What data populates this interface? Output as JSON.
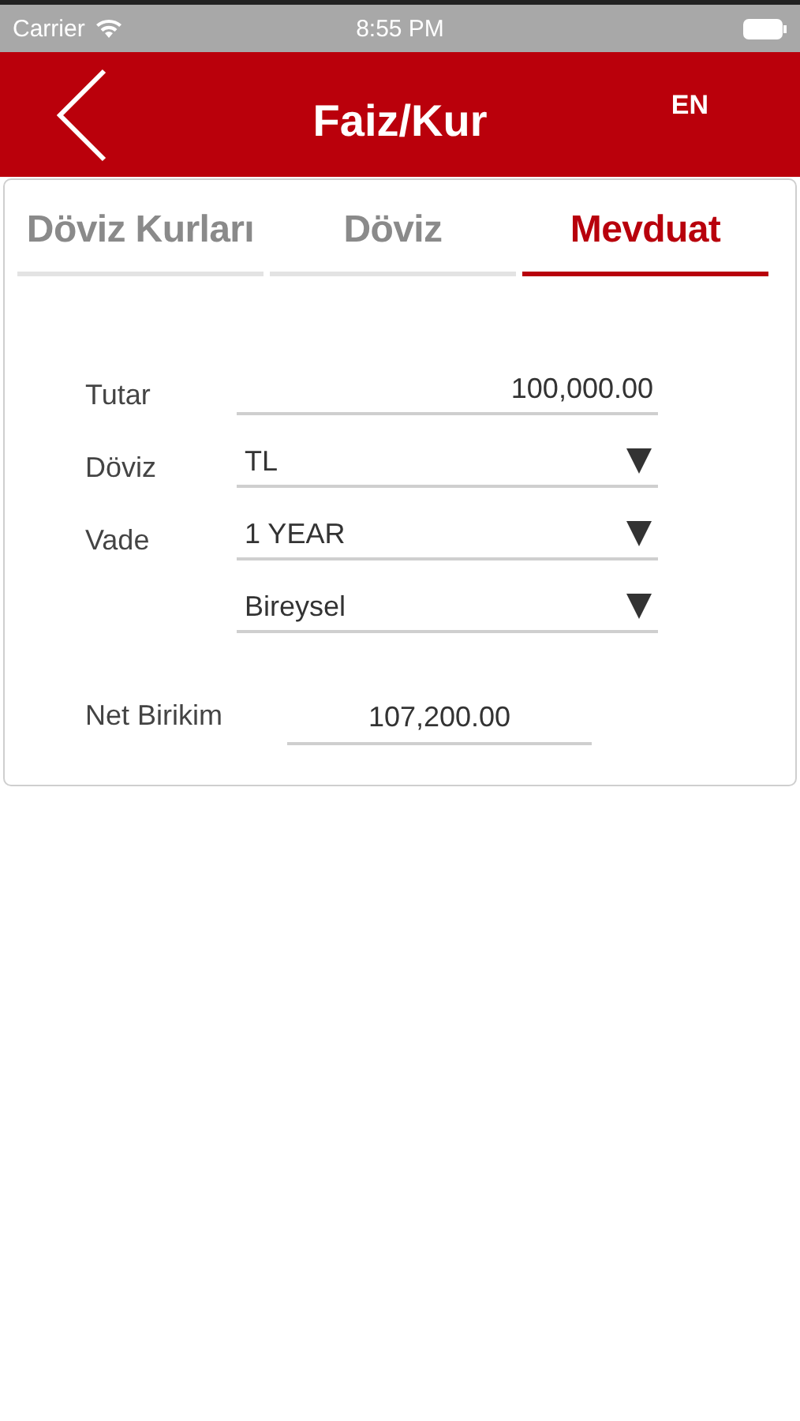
{
  "status_bar": {
    "carrier": "Carrier",
    "time": "8:55 PM"
  },
  "header": {
    "title": "Faiz/Kur",
    "language": "EN"
  },
  "tabs": [
    {
      "label": "Döviz Kurları",
      "selected": false
    },
    {
      "label": "Döviz",
      "selected": false
    },
    {
      "label": "Mevduat",
      "selected": true
    }
  ],
  "form": [
    {
      "kind": "input",
      "label": "Tutar",
      "value": "100,000.00"
    },
    {
      "kind": "select",
      "label": "Döviz",
      "value": "TL"
    },
    {
      "kind": "select",
      "label": "Vade",
      "value": "1 YEAR"
    },
    {
      "kind": "select",
      "value": "Bireysel"
    }
  ],
  "result": {
    "label": "Net Birikim",
    "value": "107,200.00"
  }
}
